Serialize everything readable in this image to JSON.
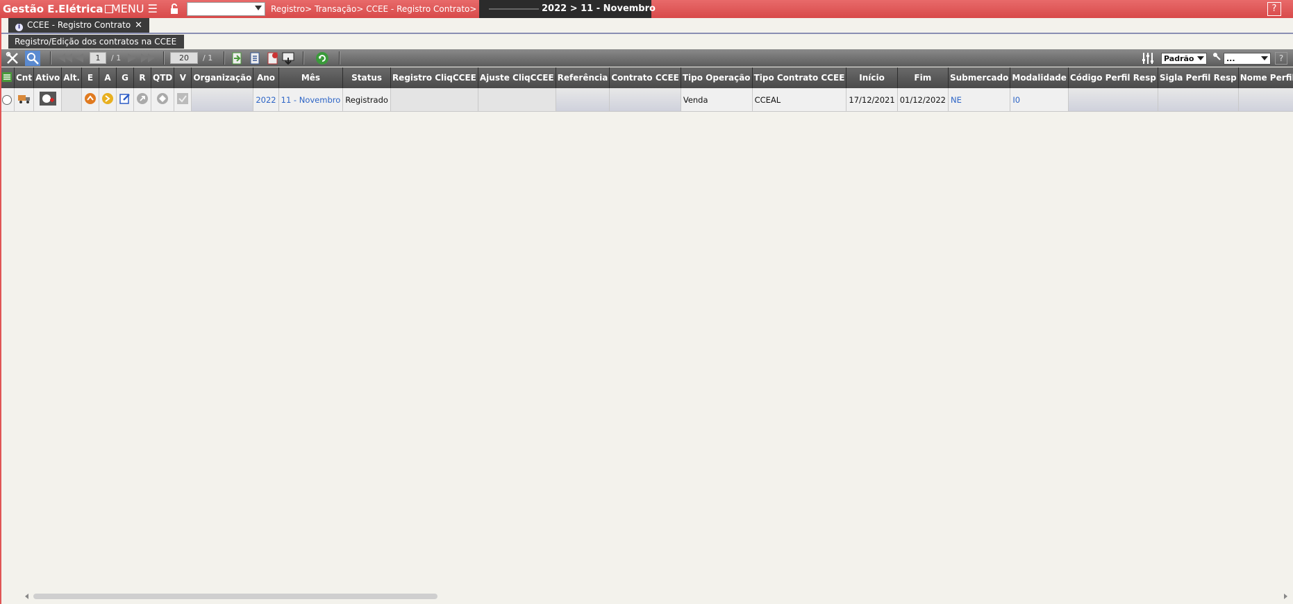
{
  "app": {
    "title": "Gestão E.Elétrica",
    "menu_label": "MENU ☰",
    "breadcrumb": "Registro> Transação> CCEE - Registro Contrato>",
    "period": "2022 > 11 - Novembro",
    "help_label": "?"
  },
  "tabs": [
    {
      "label": "CCEE - Registro Contrato",
      "close": "✕"
    }
  ],
  "subtitle": "Registro/Edição dos contratos na CCEE",
  "toolbar": {
    "page_current": "1",
    "page_total": "/ 1",
    "page_size": "20",
    "page_size_total": "/ 1",
    "view_select": "Padrão",
    "filter_select": "...",
    "help_label": "?"
  },
  "grid": {
    "columns": [
      "Cnt",
      "Ativo",
      "Alt.",
      "E",
      "A",
      "G",
      "R",
      "QTD",
      "V",
      "Organização",
      "Ano",
      "Mês",
      "Status",
      "Registro CliqCCEE",
      "Ajuste CliqCCEE",
      "Referência",
      "Contrato CCEE",
      "Tipo Operação",
      "Tipo Contrato CCEE",
      "Início",
      "Fim",
      "Submercado",
      "Modalidade",
      "Código Perfil Resp",
      "Sigla Perfil Resp",
      "Nome Perfil Resp"
    ],
    "rows": [
      {
        "ano": "2022",
        "mes": "11 - Novembro",
        "status": "Registrado",
        "tipo_operacao": "Venda",
        "tipo_contrato": "CCEAL",
        "inicio": "17/12/2021",
        "fim": "01/12/2022",
        "submercado": "NE",
        "modalidade": "I0"
      }
    ]
  },
  "colors": {
    "topbar": "#d84a4a",
    "header": "#4a4a4a",
    "link": "#2c64c6"
  }
}
